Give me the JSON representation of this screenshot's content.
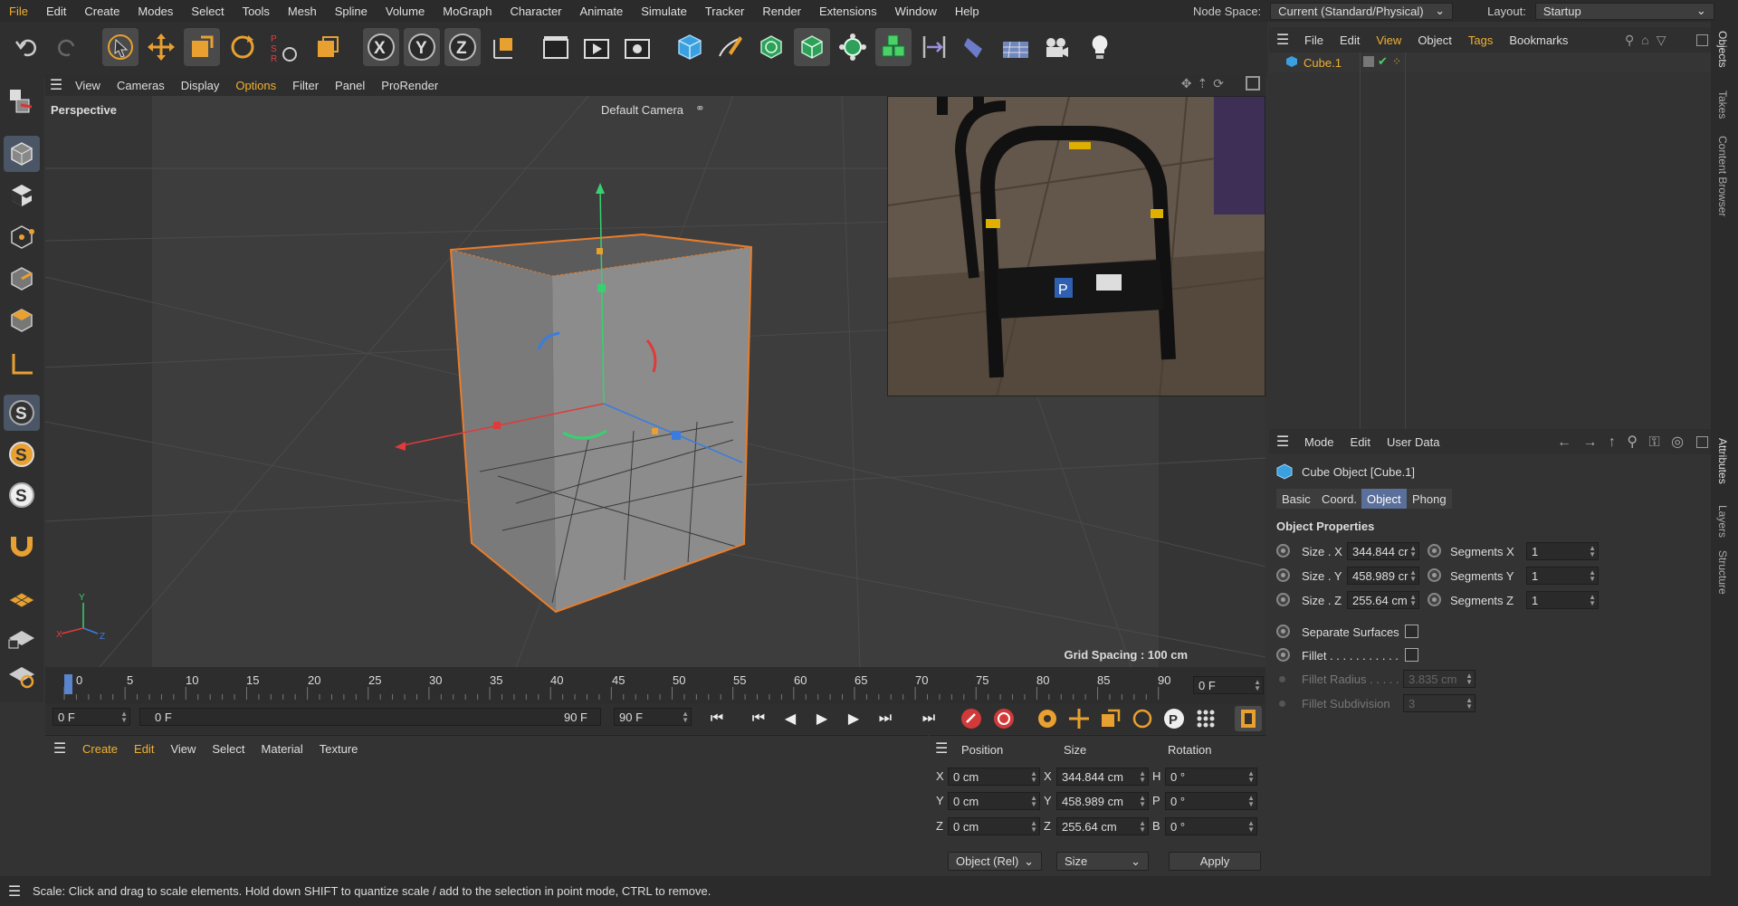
{
  "menubar": {
    "items": [
      "File",
      "Edit",
      "Create",
      "Modes",
      "Select",
      "Tools",
      "Mesh",
      "Spline",
      "Volume",
      "MoGraph",
      "Character",
      "Animate",
      "Simulate",
      "Tracker",
      "Render",
      "Extensions",
      "Window",
      "Help"
    ],
    "node_space_label": "Node Space:",
    "node_space_value": "Current (Standard/Physical)",
    "layout_label": "Layout:",
    "layout_value": "Startup"
  },
  "viewport": {
    "menu": [
      "View",
      "Cameras",
      "Display",
      "Options",
      "Filter",
      "Panel",
      "ProRender"
    ],
    "view_name": "Perspective",
    "camera": "Default Camera",
    "grid_spacing": "Grid Spacing : 100 cm",
    "axis_labels": {
      "x": "X",
      "y": "Y",
      "z": "Z"
    }
  },
  "timeline": {
    "ticks": [
      "0",
      "5",
      "10",
      "15",
      "20",
      "25",
      "30",
      "35",
      "40",
      "45",
      "50",
      "55",
      "60",
      "65",
      "70",
      "75",
      "80",
      "85",
      "90"
    ],
    "current_frame": "0 F",
    "start_field": "0 F",
    "range_start": "0 F",
    "range_end": "90 F",
    "end_field": "90 F"
  },
  "material_panel": {
    "menu": [
      "Create",
      "Edit",
      "View",
      "Select",
      "Material",
      "Texture"
    ]
  },
  "coord_panel": {
    "headers": [
      "Position",
      "Size",
      "Rotation"
    ],
    "rows": [
      {
        "axis": "X",
        "pos": "0 cm",
        "size_axis": "X",
        "size": "344.844 cm",
        "rot_axis": "H",
        "rot": "0 °"
      },
      {
        "axis": "Y",
        "pos": "0 cm",
        "size_axis": "Y",
        "size": "458.989 cm",
        "rot_axis": "P",
        "rot": "0 °"
      },
      {
        "axis": "Z",
        "pos": "0 cm",
        "size_axis": "Z",
        "size": "255.64 cm",
        "rot_axis": "B",
        "rot": "0 °"
      }
    ],
    "mode_select": "Object (Rel)",
    "size_select": "Size",
    "apply": "Apply"
  },
  "object_manager": {
    "menu": [
      "File",
      "Edit",
      "View",
      "Object",
      "Tags",
      "Bookmarks"
    ],
    "objects": [
      {
        "name": "Cube.1"
      }
    ]
  },
  "attributes": {
    "menu": [
      "Mode",
      "Edit",
      "User Data"
    ],
    "title": "Cube Object [Cube.1]",
    "tabs": [
      "Basic",
      "Coord.",
      "Object",
      "Phong"
    ],
    "active_tab": "Object",
    "section": "Object Properties",
    "size_x_label": "Size . X",
    "size_x": "344.844 cr",
    "size_y_label": "Size . Y",
    "size_y": "458.989 cr",
    "size_z_label": "Size . Z",
    "size_z": "255.64 cm",
    "seg_x_label": "Segments X",
    "seg_x": "1",
    "seg_y_label": "Segments Y",
    "seg_y": "1",
    "seg_z_label": "Segments Z",
    "seg_z": "1",
    "separate_surfaces": "Separate Surfaces",
    "fillet": "Fillet . . . . . . . . . . .",
    "fillet_radius_label": "Fillet Radius . . . . .",
    "fillet_radius": "3.835 cm",
    "fillet_subdiv_label": "Fillet Subdivision",
    "fillet_subdiv": "3"
  },
  "side_tabs": [
    "Objects",
    "Takes",
    "Content Browser",
    "Attributes",
    "Layers",
    "Structure"
  ],
  "status": "Scale: Click and drag to scale elements. Hold down SHIFT to quantize scale / add to the selection in point mode, CTRL to remove.",
  "colors": {
    "accent": "#f0b030",
    "selection": "#e87d2c",
    "tab_active": "#5a6f99"
  }
}
